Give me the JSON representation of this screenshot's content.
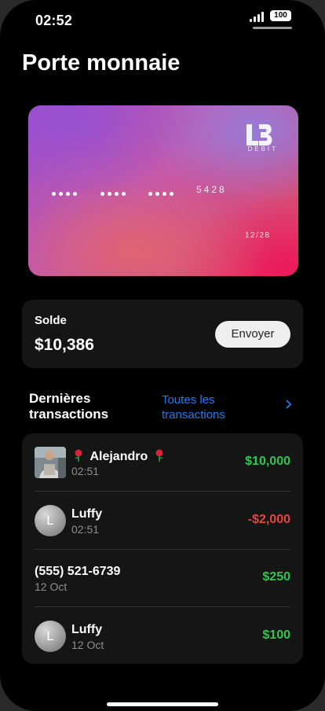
{
  "status_bar": {
    "time": "02:52",
    "battery": "100"
  },
  "page_title": "Porte monnaie",
  "card": {
    "brand_sub": "DEBIT",
    "last4": "5428",
    "expiry": "12/28"
  },
  "balance": {
    "label": "Solde",
    "value": "$10,386",
    "send_label": "Envoyer"
  },
  "transactions_header": {
    "title_line1": "Dernières",
    "title_line2": "transactions",
    "see_all_line1": "Toutes les",
    "see_all_line2": "transactions"
  },
  "transactions": [
    {
      "name": "Alejandro",
      "sub": "02:51",
      "amount": "$10,000",
      "type": "credit",
      "avatar": "photo"
    },
    {
      "name": "Luffy",
      "sub": "02:51",
      "amount": "-$2,000",
      "type": "debit",
      "avatar_letter": "L"
    },
    {
      "name": "(555) 521-6739",
      "sub": "12 Oct",
      "amount": "$250",
      "type": "credit"
    },
    {
      "name": "Luffy",
      "sub": "12 Oct",
      "amount": "$100",
      "type": "credit",
      "avatar_letter": "L"
    }
  ],
  "colors": {
    "credit": "#2fc552",
    "debit": "#e8453c",
    "link": "#1e7cf2"
  },
  "icons": {
    "signal": "signal-icon",
    "battery": "battery-icon",
    "chevron": "chevron-right-icon",
    "rose": "rose-emoji-icon"
  }
}
